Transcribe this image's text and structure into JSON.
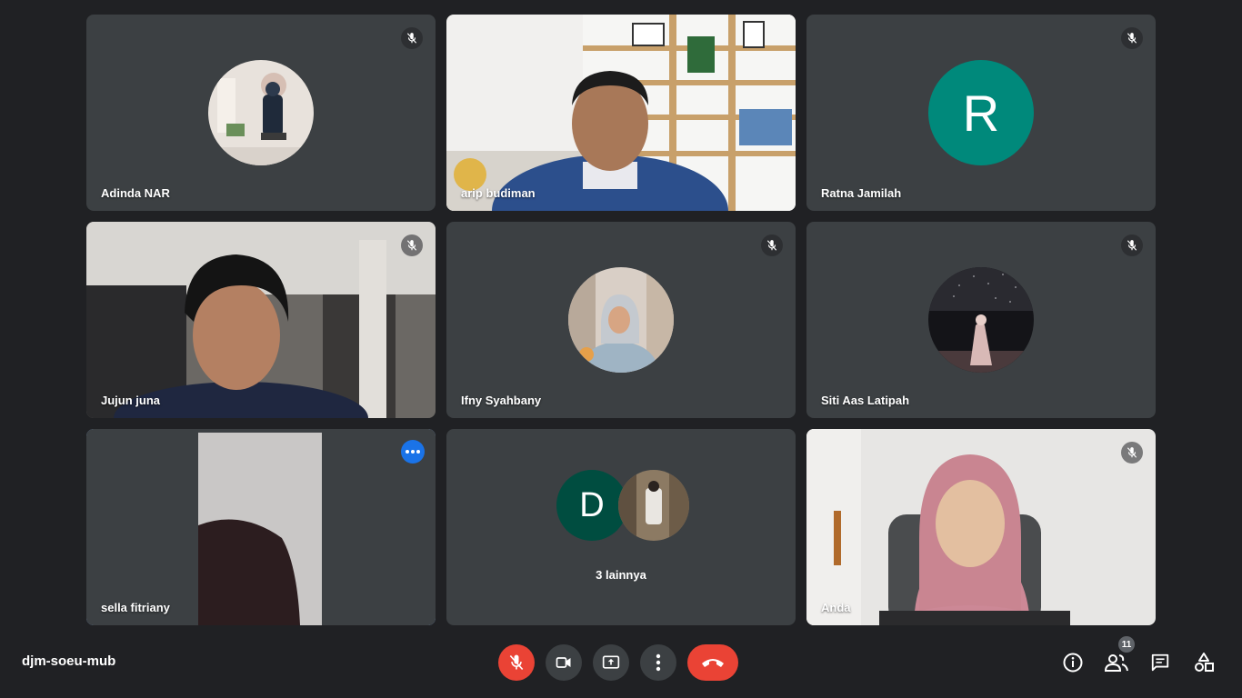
{
  "meeting": {
    "code": "djm-soeu-mub"
  },
  "tiles": [
    {
      "name": "Adinda NAR",
      "kind": "photo-avatar",
      "muted": true
    },
    {
      "name": "arip budiman",
      "kind": "video",
      "muted": false
    },
    {
      "name": "Ratna Jamilah",
      "kind": "letter-avatar",
      "letter": "R",
      "avatar_color": "#00897b",
      "muted": true
    },
    {
      "name": "Jujun juna",
      "kind": "video",
      "muted": true
    },
    {
      "name": "Ifny Syahbany",
      "kind": "photo-avatar",
      "muted": true
    },
    {
      "name": "Siti Aas Latipah",
      "kind": "photo-avatar",
      "muted": true
    },
    {
      "name": "sella fitriany",
      "kind": "video",
      "active": true
    },
    {
      "kind": "others",
      "letter": "D",
      "avatar_color": "#004d40",
      "label": "3 lainnya"
    },
    {
      "name": "Anda",
      "kind": "video",
      "muted": true
    }
  ],
  "participants": {
    "count": "11"
  },
  "controls": [
    "mic-off-icon",
    "camera-icon",
    "present-screen-icon",
    "more-options-icon",
    "hang-up-icon"
  ],
  "right_controls": [
    "info-icon",
    "people-icon",
    "chat-icon",
    "activities-icon"
  ],
  "colors": {
    "background": "#202124",
    "tile": "#3c4043",
    "danger": "#ea4335",
    "accent": "#1a73e8",
    "active_outline": "#8ab4f8"
  }
}
